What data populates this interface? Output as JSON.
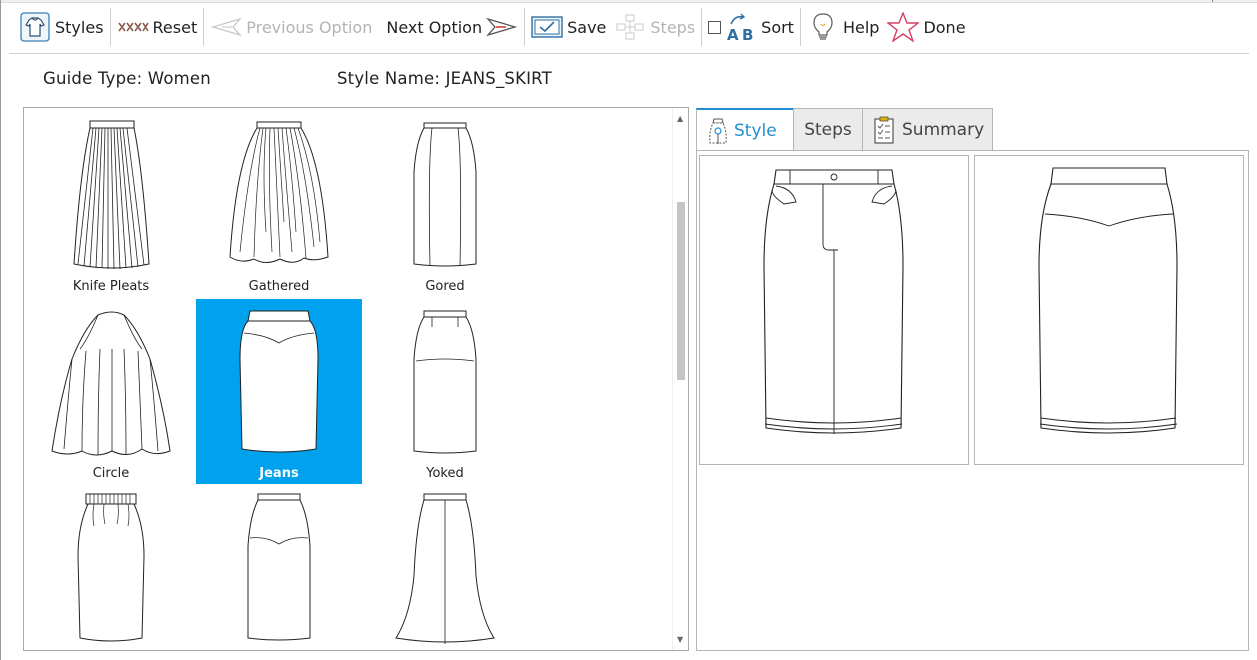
{
  "toolbar": {
    "styles": "Styles",
    "reset": "Reset",
    "previous_option": "Previous Option",
    "next_option": "Next Option",
    "save": "Save",
    "steps": "Steps",
    "sort": "Sort",
    "sort_checked": false,
    "help": "Help",
    "done": "Done"
  },
  "info": {
    "guide_type": "Guide Type: Women",
    "style_name": "Style Name: JEANS_SKIRT"
  },
  "gallery": {
    "selected": "Jeans",
    "items": [
      {
        "label": "Knife Pleats",
        "icon": "knife-pleats-skirt-icon"
      },
      {
        "label": "Gathered",
        "icon": "gathered-skirt-icon"
      },
      {
        "label": "Gored",
        "icon": "gored-skirt-icon"
      },
      {
        "label": "Circle",
        "icon": "circle-skirt-icon"
      },
      {
        "label": "Jeans",
        "icon": "jeans-skirt-icon"
      },
      {
        "label": "Yoked",
        "icon": "yoked-skirt-icon"
      },
      {
        "label": "",
        "icon": "elastic-waist-skirt-icon"
      },
      {
        "label": "",
        "icon": "yoke-pencil-skirt-icon"
      },
      {
        "label": "",
        "icon": "flared-gored-skirt-icon"
      }
    ]
  },
  "tabs": [
    {
      "label": "Style",
      "icon": "style-tab-icon",
      "active": true
    },
    {
      "label": "Steps",
      "active": false
    },
    {
      "label": "Summary",
      "icon": "summary-tab-icon",
      "active": false
    }
  ],
  "preview": {
    "front": "jeans-skirt-front-view",
    "back": "jeans-skirt-back-view"
  },
  "colors": {
    "selection": "#00a2ee",
    "active_tab": "#1e8fd0",
    "disabled_text": "#b4b4b4"
  }
}
